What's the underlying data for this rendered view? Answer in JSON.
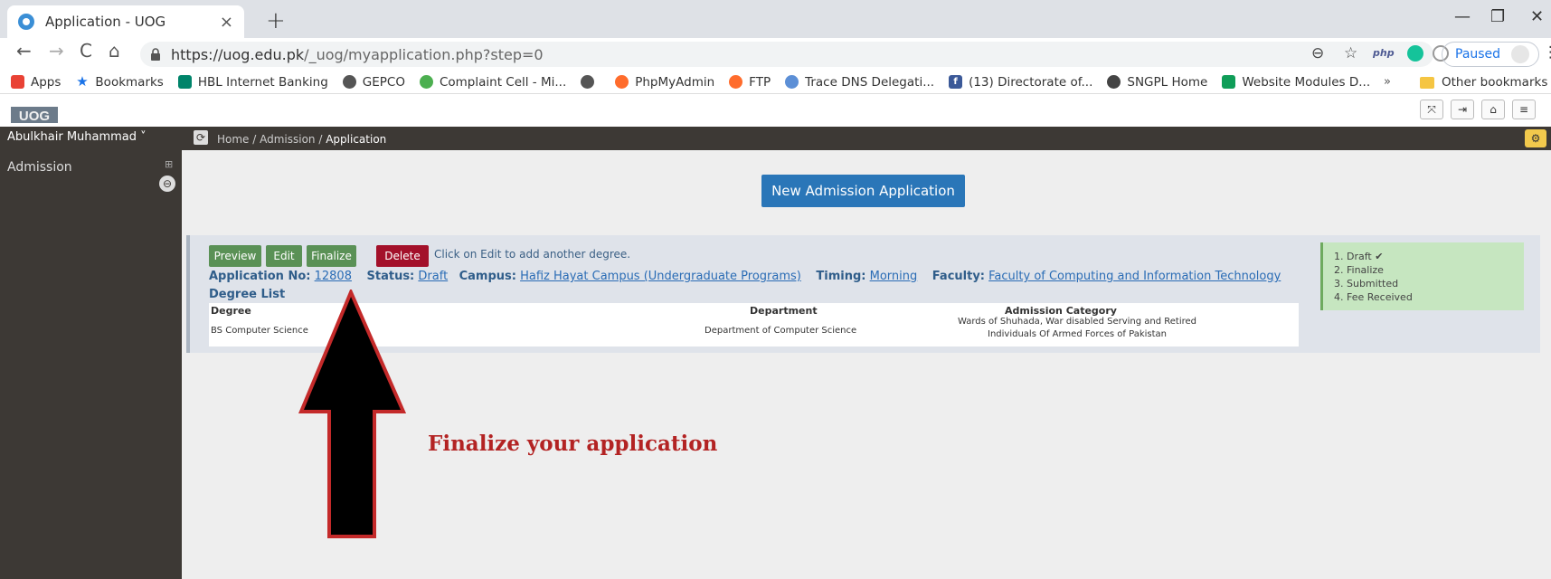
{
  "browser": {
    "tab_title": "Application - UOG",
    "tab_close": "×",
    "new_tab": "+",
    "url_host": "https://uog.edu.pk",
    "url_path": "/_uog/myapplication.php?step=0",
    "profile_label": "Paused",
    "nav": {
      "back": "←",
      "forward": "→",
      "reload": "C",
      "home": "⌂"
    },
    "omni_icons": {
      "zoom": "⊖",
      "star": "☆",
      "php": "php",
      "more": "⋮"
    },
    "window": {
      "minimize": "—",
      "maximize": "❐",
      "close": "✕"
    },
    "bookmarks": [
      {
        "label": "Apps",
        "icon": "apps-grid-icon",
        "color": "#e94235"
      },
      {
        "label": "Bookmarks",
        "icon": "star-icon",
        "color": "#1a73e8"
      },
      {
        "label": "HBL Internet Banking",
        "icon": "hbl-icon",
        "color": "#00846a"
      },
      {
        "label": "GEPCO",
        "icon": "globe-icon",
        "color": "#555555"
      },
      {
        "label": "Complaint Cell - Mi...",
        "icon": "complaint-icon",
        "color": "#4caf50"
      },
      {
        "label": "",
        "icon": "globe-icon",
        "color": "#555555"
      },
      {
        "label": "PhpMyAdmin",
        "icon": "cpanel-icon",
        "color": "#ff6c2c"
      },
      {
        "label": "FTP",
        "icon": "cpanel-icon",
        "color": "#ff6c2c"
      },
      {
        "label": "Trace DNS Delegati...",
        "icon": "dns-icon",
        "color": "#5c8fd6"
      },
      {
        "label": "(13) Directorate of...",
        "icon": "facebook-icon",
        "color": "#3b5998"
      },
      {
        "label": "SNGPL Home",
        "icon": "sngpl-icon",
        "color": "#444444"
      },
      {
        "label": "Website Modules D...",
        "icon": "sheets-icon",
        "color": "#0f9d58"
      }
    ],
    "more_bookmarks": "»",
    "other_bookmarks": "Other bookmarks"
  },
  "header": {
    "logo_text": "UOG",
    "buttons": [
      "⤧",
      "⇥",
      "⌂",
      "≡"
    ]
  },
  "topbar": {
    "user": "Abulkhair Muhammad ˅",
    "breadcrumb": [
      "Home",
      "Admission",
      "Application"
    ],
    "separator": " / ",
    "refresh": "⟳",
    "settings": "⚙"
  },
  "sidebar": {
    "items": [
      {
        "label": "Admission",
        "expand": "⊞"
      }
    ],
    "collapse": "⊖"
  },
  "main": {
    "new_application": "New Admission Application",
    "actions": [
      {
        "label": "Preview",
        "color": "#5a9156"
      },
      {
        "label": "Edit",
        "color": "#5a9156"
      },
      {
        "label": "Finalize",
        "color": "#5a9156"
      },
      {
        "label": "Delete",
        "color": "#a3102a"
      }
    ],
    "hint": "Click on Edit to add another degree.",
    "application": {
      "no_label": "Application No:",
      "no": "12808",
      "status_label": "Status:",
      "status": "Draft",
      "campus_label": "Campus:",
      "campus": "Hafiz Hayat Campus (Undergraduate Programs)",
      "timing_label": "Timing:",
      "timing": "Morning",
      "faculty_label": "Faculty:",
      "faculty": "Faculty of Computing and Information Technology"
    },
    "degree_list_title": "Degree List",
    "table": {
      "headers": [
        "Degree",
        "Department",
        "Admission Category"
      ],
      "rows": [
        [
          "BS Computer Science",
          "Department of Computer Science",
          "Wards of Shuhada, War disabled Serving and Retired",
          "Individuals Of Armed Forces of Pakistan"
        ]
      ]
    },
    "steps": [
      "1. Draft ✔",
      "2. Finalize",
      "3. Submitted",
      "4. Fee Received"
    ]
  },
  "annotation": {
    "text": "Finalize your application",
    "color": "#b32323"
  }
}
